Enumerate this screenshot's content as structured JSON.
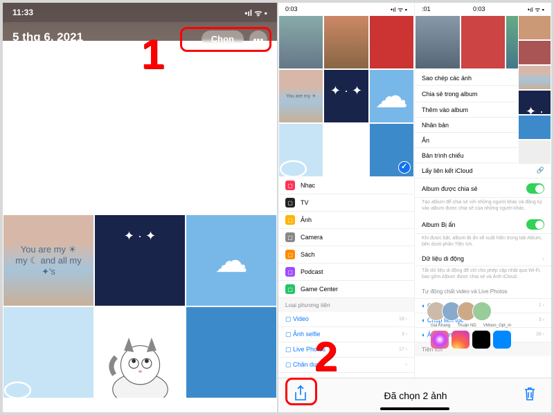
{
  "annotations": {
    "step1": "1",
    "step2": "2"
  },
  "pane1": {
    "status_time": "11:33",
    "date": "5 thg 6, 2021",
    "select_button": "Chọn",
    "quote_line1": "You are my ☀",
    "quote_line2": "my ☾ and all my",
    "quote_line3": "✦'s"
  },
  "pane2": {
    "status_time_left": "0:03",
    "status_time_right": "0:03",
    "settings_left": [
      {
        "label": "Nhạc",
        "color": "#ff3355"
      },
      {
        "label": "TV",
        "color": "#222"
      },
      {
        "label": "Ảnh",
        "color": "#ffb300"
      },
      {
        "label": "Camera",
        "color": "#888"
      },
      {
        "label": "Sách",
        "color": "#ff8a00"
      },
      {
        "label": "Podcast",
        "color": "#a14bff"
      },
      {
        "label": "Game Center",
        "color": "#25c466"
      }
    ],
    "media_cat": "Loại phương tiện",
    "media_items": [
      {
        "label": "Video",
        "count": "19"
      },
      {
        "label": "Ảnh selfie",
        "count": "3"
      },
      {
        "label": "Live Photos",
        "count": "17"
      },
      {
        "label": "Chân dung",
        "count": ""
      }
    ],
    "action_sheet": [
      {
        "label": "Sao chép các ảnh",
        "icon": "⧉"
      },
      {
        "label": "Chia sẻ trong album",
        "icon": "⤴"
      },
      {
        "label": "Thêm vào album",
        "icon": "▭"
      },
      {
        "label": "Nhân bản",
        "icon": "⊕"
      },
      {
        "label": "Ẩn",
        "icon": "◉"
      },
      {
        "label": "Bản trình chiếu",
        "icon": "▷"
      },
      {
        "label": "Lấy liên kết iCloud",
        "icon": "🔗"
      }
    ],
    "album_shared": "Album được chia sẻ",
    "album_shared_desc": "Tạo album để chia sẻ với những người khác và đăng ký vào album được chia sẻ của những người khác.",
    "album_hidden": "Album Bị ẩn",
    "album_hidden_desc": "Khi được bật, album Bị ẩn sẽ xuất hiện trong tab Album, bên dưới phần Tiện ích.",
    "data_mobile": "Dữ liệu di động",
    "data_mobile_desc": "Tắt dữ liệu di động để chỉ cho phép cập nhật qua Wi-Fi, bao gồm Album được chia sẻ và Ảnh iCloud.",
    "transfer": "Tự động chất video và Live Photos",
    "util_cat": "Tiện ích",
    "util_items": [
      {
        "label": "Chân dung",
        "count": "1"
      },
      {
        "label": "Chụp liên tục",
        "count": "3"
      },
      {
        "label": "Ảnh màn hình",
        "count": "28"
      }
    ],
    "share_contacts": [
      "Gia Khang",
      "Thuận ND",
      "VMoon_Opt_m"
    ],
    "bottom_selected": "Đã chọn 2 ảnh"
  }
}
